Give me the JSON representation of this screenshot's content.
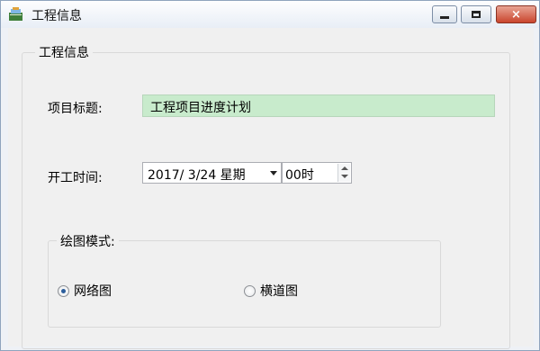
{
  "window": {
    "title": "工程信息",
    "minimize": "minimize",
    "maximize": "maximize",
    "close": "×"
  },
  "group": {
    "label": "工程信息"
  },
  "project_title": {
    "label": "项目标题:",
    "value": "工程项目进度计划"
  },
  "start_time": {
    "label": "开工时间:",
    "date": "2017/ 3/24 星期",
    "hour": "00时"
  },
  "drawing_mode": {
    "label": "绘图模式:",
    "options": [
      {
        "label": "网络图",
        "checked": true
      },
      {
        "label": "横道图",
        "checked": false
      }
    ]
  },
  "colors": {
    "title_input_bg": "#c8ebcc",
    "close_button": "#c9452d",
    "radio_dot": "#2c5e9c"
  },
  "icons": {
    "app": "app-icon",
    "minimize": "minimize-icon",
    "maximize": "maximize-icon",
    "close": "close-icon"
  }
}
